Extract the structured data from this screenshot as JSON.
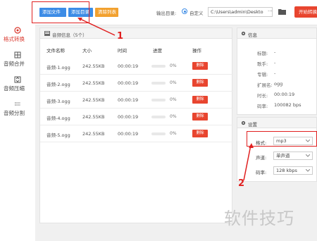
{
  "sidebar": {
    "items": [
      {
        "label": "格式转换",
        "icon": "convert-icon",
        "active": true
      },
      {
        "label": "音频合并",
        "icon": "merge-icon",
        "active": false
      },
      {
        "label": "音频压缩",
        "icon": "compress-icon",
        "active": false
      },
      {
        "label": "音频分割",
        "icon": "split-icon",
        "active": false
      }
    ]
  },
  "toolbar": {
    "add_file": "添加文件",
    "add_dir": "添加目录",
    "clear_list": "清除列表",
    "output_label": "输出目录:",
    "custom_label": "自定义",
    "output_path": "C:\\Users\\admin\\Deskto",
    "more": "···",
    "start": "开始转换"
  },
  "list": {
    "title": "音频信息（5个）",
    "columns": {
      "name": "文件名称",
      "size": "大小",
      "time": "时间",
      "progress": "进度",
      "action": "操作"
    },
    "rows": [
      {
        "name": "音频-1.ogg",
        "size": "242.55KB",
        "time": "00:00:19",
        "progress_text": "0%",
        "progress": 0,
        "action": "删除"
      },
      {
        "name": "音频-2.ogg",
        "size": "242.55KB",
        "time": "00:00:19",
        "progress_text": "0%",
        "progress": 0,
        "action": "删除"
      },
      {
        "name": "音频-3.ogg",
        "size": "242.55KB",
        "time": "00:00:19",
        "progress_text": "0%",
        "progress": 0,
        "action": "删除"
      },
      {
        "name": "音频-4.ogg",
        "size": "242.55KB",
        "time": "00:00:19",
        "progress_text": "0%",
        "progress": 0,
        "action": "删除"
      },
      {
        "name": "音频-5.ogg",
        "size": "242.55KB",
        "time": "00:00:19",
        "progress_text": "0%",
        "progress": 0,
        "action": "删除"
      }
    ]
  },
  "info": {
    "title": "信息",
    "fields": [
      {
        "label": "标题:",
        "value": "-"
      },
      {
        "label": "歌手:",
        "value": "-"
      },
      {
        "label": "专辑:",
        "value": "-"
      },
      {
        "label": "扩展名:",
        "value": "ogg"
      },
      {
        "label": "时长:",
        "value": "00:00:19"
      },
      {
        "label": "码率:",
        "value": "100082 bps"
      }
    ]
  },
  "settings": {
    "title": "设置",
    "format_label": "格式:",
    "format_value": "mp3",
    "channel_label": "声道:",
    "channel_value": "单声道",
    "bitrate_label": "码率:",
    "bitrate_value": "128 kbps"
  },
  "annotations": {
    "step1": "1",
    "step2": "2"
  },
  "watermark": "软件技巧",
  "colors": {
    "accent_blue": "#3d8ce6",
    "accent_orange": "#f2a12f",
    "danger_red": "#e8452f",
    "annotation_red": "#e02020"
  }
}
